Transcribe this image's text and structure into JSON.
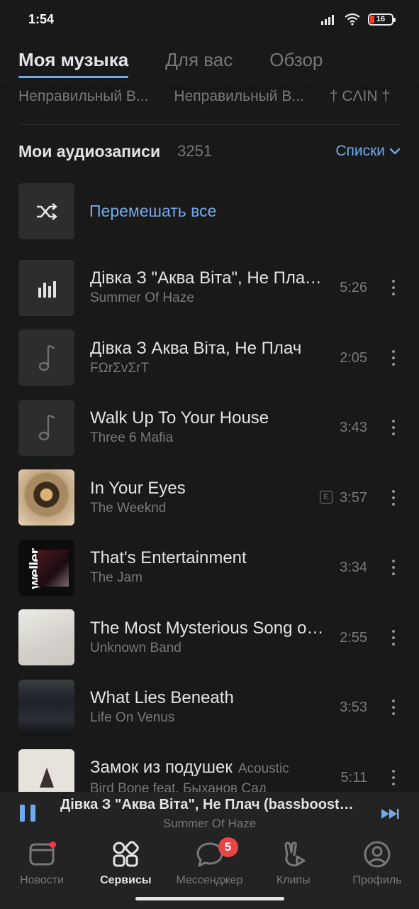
{
  "status_bar": {
    "time": "1:54",
    "battery": "16"
  },
  "tabs": [
    {
      "label": "Моя музыка"
    },
    {
      "label": "Для вас"
    },
    {
      "label": "Обзор"
    }
  ],
  "playlists": [
    {
      "label": "Неправильный В..."
    },
    {
      "label": "Неправильный В..."
    },
    {
      "label": "† CΛIN †"
    }
  ],
  "section": {
    "title": "Мои аудиозаписи",
    "count": "3251",
    "lists_label": "Списки"
  },
  "shuffle": {
    "label": "Перемешать все"
  },
  "tracks": [
    {
      "title": "Дівка З \"Аква Віта\", Не Плач (bassboosted)",
      "subtitle": "",
      "artist": "Summer Of Haze",
      "duration": "5:26",
      "art": "playing-bars-icon",
      "explicit": false
    },
    {
      "title": "Дівка З Аква Віта, Не Плач",
      "subtitle": "",
      "artist": "FΩrΣvΣrT",
      "duration": "2:05",
      "art": "music-note-icon",
      "explicit": false
    },
    {
      "title": "Walk Up To Your House",
      "subtitle": "",
      "artist": "Three 6 Mafia",
      "duration": "3:43",
      "art": "music-note-icon",
      "explicit": false
    },
    {
      "title": "In Your Eyes",
      "subtitle": "",
      "artist": "The Weeknd",
      "duration": "3:57",
      "art": "album-cover",
      "explicit": true,
      "explicit_label": "E"
    },
    {
      "title": "That's Entertainment",
      "subtitle": "",
      "artist": "The Jam",
      "duration": "3:34",
      "art": "album-cover",
      "explicit": false,
      "cover_text": "weller"
    },
    {
      "title": "The Most Mysterious Song on the Internet",
      "subtitle": "",
      "artist": "Unknown Band",
      "duration": "2:55",
      "art": "album-cover",
      "explicit": false
    },
    {
      "title": "What Lies Beneath",
      "subtitle": "",
      "artist": "Life On Venus",
      "duration": "3:53",
      "art": "album-cover",
      "explicit": false
    },
    {
      "title": "Замок из подушек",
      "subtitle": "Acoustic",
      "artist": "Bird Bone feat. Быханов Сад",
      "duration": "5:11",
      "art": "album-cover",
      "explicit": false
    }
  ],
  "now_playing": {
    "title": "Дівка З \"Аква Віта\", Не Плач (bassboosted)",
    "artist": "Summer Of Haze"
  },
  "bottom_nav": [
    {
      "label": "Новости",
      "icon": "news-icon"
    },
    {
      "label": "Сервисы",
      "icon": "services-icon"
    },
    {
      "label": "Мессенджер",
      "icon": "messenger-icon",
      "badge": "5"
    },
    {
      "label": "Клипы",
      "icon": "clips-icon"
    },
    {
      "label": "Профиль",
      "icon": "profile-icon"
    }
  ],
  "colors": {
    "background": "#19191a",
    "accent": "#71aaeb",
    "secondary_text": "#76787a",
    "badge": "#e64646"
  }
}
